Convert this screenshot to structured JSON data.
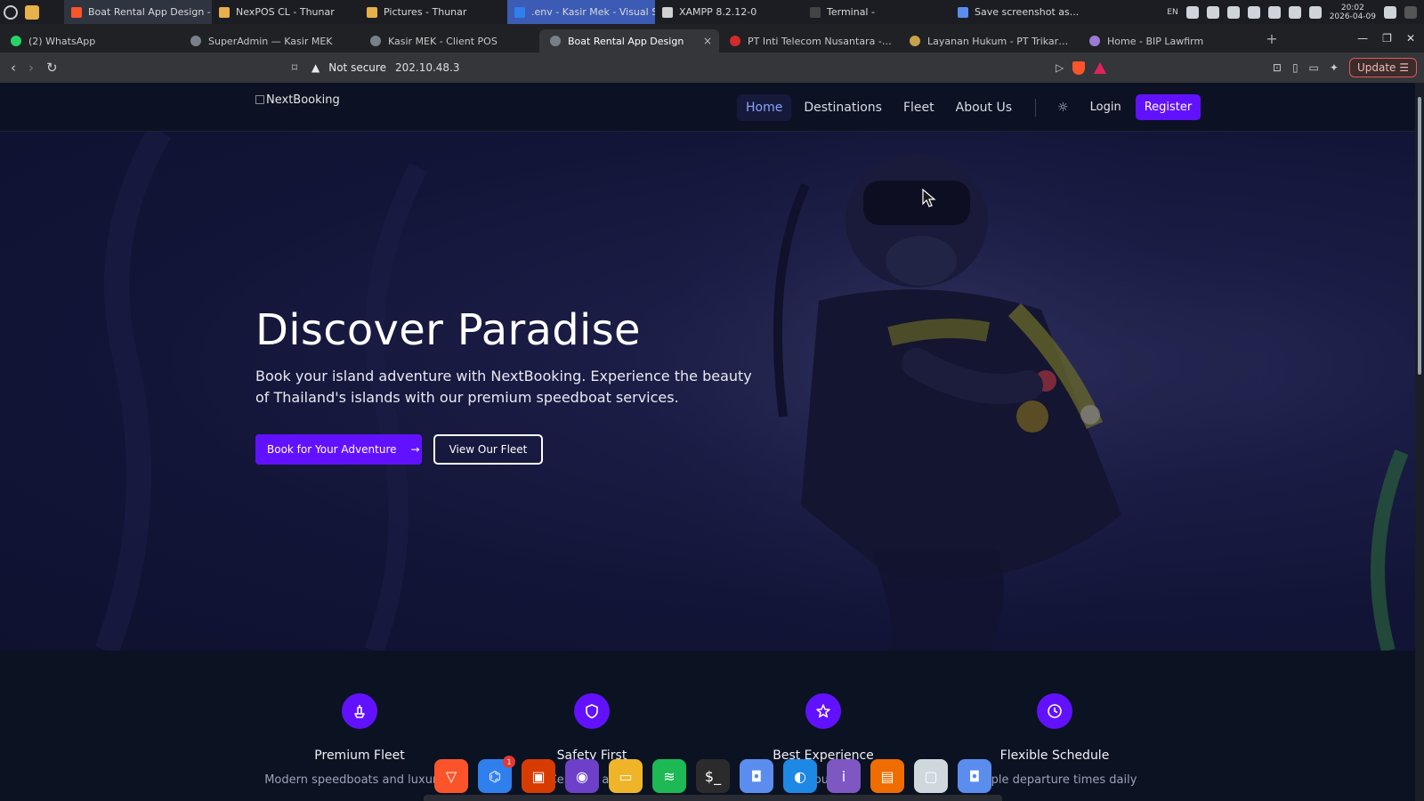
{
  "os": {
    "tasks": [
      {
        "label": "Boat Rental App Design - B...",
        "icon": "brave-icon",
        "color": "#fb542b",
        "state": "active"
      },
      {
        "label": "NexPOS CL - Thunar",
        "icon": "folder-icon",
        "color": "#e8b04a",
        "state": ""
      },
      {
        "label": "Pictures - Thunar",
        "icon": "folder-icon",
        "color": "#e8b04a",
        "state": ""
      },
      {
        "label": ".env - Kasir Mek - Visual St...",
        "icon": "vscode-icon",
        "color": "#2f80ed",
        "state": "hl"
      },
      {
        "label": "XAMPP 8.2.12-0",
        "icon": "window-icon",
        "color": "#d0d0d0",
        "state": ""
      },
      {
        "label": "Terminal -",
        "icon": "terminal-icon",
        "color": "#444",
        "state": ""
      },
      {
        "label": "Save screenshot as...",
        "icon": "camera-icon",
        "color": "#5b8def",
        "state": ""
      }
    ],
    "lang": "EN",
    "clock_time": "20:02",
    "clock_date": "2026-04-09"
  },
  "browser": {
    "tabs": [
      {
        "label": "(2) WhatsApp",
        "color": "#25d366",
        "active": false
      },
      {
        "label": "SuperAdmin — Kasir MEK",
        "color": "#7b7f88",
        "active": false
      },
      {
        "label": "Kasir MEK - Client POS",
        "color": "#7b7f88",
        "active": false
      },
      {
        "label": "Boat Rental App Design",
        "color": "#7b7f88",
        "active": true
      },
      {
        "label": "PT Inti Telecom Nusantara - Infras",
        "color": "#d12b2b",
        "active": false
      },
      {
        "label": "Layanan Hukum - PT Trikarsa Lega",
        "color": "#c8a14a",
        "active": false
      },
      {
        "label": "Home - BIP Lawfirm",
        "color": "#9b7bd6",
        "active": false
      }
    ],
    "tab_close": "×",
    "new_tab": "+",
    "security_label": "Not secure",
    "url": "202.10.48.3",
    "update_label": "Update"
  },
  "site": {
    "logo_alt": "NextBooking",
    "nav": [
      {
        "label": "Home",
        "active": true
      },
      {
        "label": "Destinations",
        "active": false
      },
      {
        "label": "Fleet",
        "active": false
      },
      {
        "label": "About Us",
        "active": false
      }
    ],
    "login": "Login",
    "register": "Register",
    "hero": {
      "title": "Discover Paradise",
      "subtitle": "Book your island adventure with NextBooking. Experience the beauty of Thailand's islands with our premium speedboat services.",
      "primary_cta": "Book for Your Adventure",
      "secondary_cta": "View Our Fleet"
    },
    "features": [
      {
        "title": "Premium Fleet",
        "desc": "Modern speedboats and luxury y",
        "icon": "boat-icon"
      },
      {
        "title": "Safety First",
        "desc": "Certified and...",
        "icon": "shield-icon"
      },
      {
        "title": "Best Experience",
        "desc": "...our...",
        "icon": "star-icon"
      },
      {
        "title": "Flexible Schedule",
        "desc": "...tiple departure times daily",
        "icon": "clock-icon"
      }
    ]
  },
  "dock": [
    {
      "name": "brave-dock-icon",
      "color": "#fb542b",
      "glyph": "▽"
    },
    {
      "name": "vscode-dock-icon",
      "color": "#2f80ed",
      "glyph": "⌬",
      "badge": "1"
    },
    {
      "name": "office-dock-icon",
      "color": "#d83b01",
      "glyph": "▣"
    },
    {
      "name": "github-dock-icon",
      "color": "#6e40c9",
      "glyph": "◉"
    },
    {
      "name": "files-dock-icon",
      "color": "#f0b429",
      "glyph": "▭"
    },
    {
      "name": "spotify-dock-icon",
      "color": "#1db954",
      "glyph": "≋"
    },
    {
      "name": "terminal-dock-icon",
      "color": "#2b2b2b",
      "glyph": "$_"
    },
    {
      "name": "screenshot-dock-icon",
      "color": "#5b8def",
      "glyph": "◘"
    },
    {
      "name": "browser-dock-icon",
      "color": "#1e88e5",
      "glyph": "◐"
    },
    {
      "name": "info-dock-icon",
      "color": "#7e57c2",
      "glyph": "i"
    },
    {
      "name": "document-dock-icon",
      "color": "#ef6c00",
      "glyph": "▤"
    },
    {
      "name": "window-dock-icon",
      "color": "#cfd8dc",
      "glyph": "▢"
    },
    {
      "name": "camera-dock-icon",
      "color": "#5b8def",
      "glyph": "◘"
    }
  ]
}
